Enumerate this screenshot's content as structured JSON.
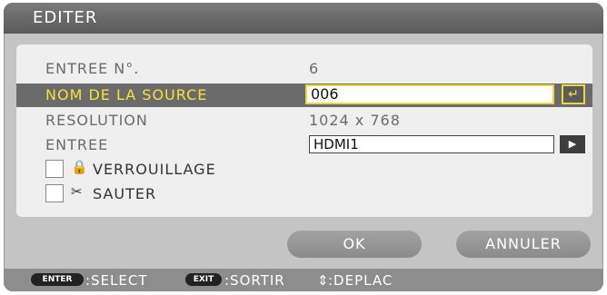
{
  "dialog": {
    "title": "EDITER"
  },
  "form": {
    "entry_number": {
      "label": "ENTREE N°.",
      "value": "6"
    },
    "source_name": {
      "label": "NOM DE LA SOURCE",
      "value": "006",
      "enter_icon": "return-arrow-icon"
    },
    "resolution": {
      "label": "RESOLUTION",
      "value": "1024 x 768"
    },
    "input": {
      "label": "ENTREE",
      "value": "HDMI1",
      "button_icon": "play-arrow-icon"
    },
    "lock": {
      "label": "VERROUILLAGE",
      "checked": false,
      "icon": "lock-icon"
    },
    "skip": {
      "label": "SAUTER",
      "checked": false,
      "icon": "skip-icon"
    }
  },
  "buttons": {
    "ok": "OK",
    "cancel": "ANNULER"
  },
  "footer": {
    "enter_key": "ENTER",
    "enter_action": ":SELECT",
    "exit_key": "EXIT",
    "exit_action": ":SORTIR",
    "move_action": ":DEPLAC"
  },
  "colors": {
    "highlight_text": "#f7e23a",
    "selected_row": "#6b6b6b",
    "field_border": "#e9d83a"
  }
}
